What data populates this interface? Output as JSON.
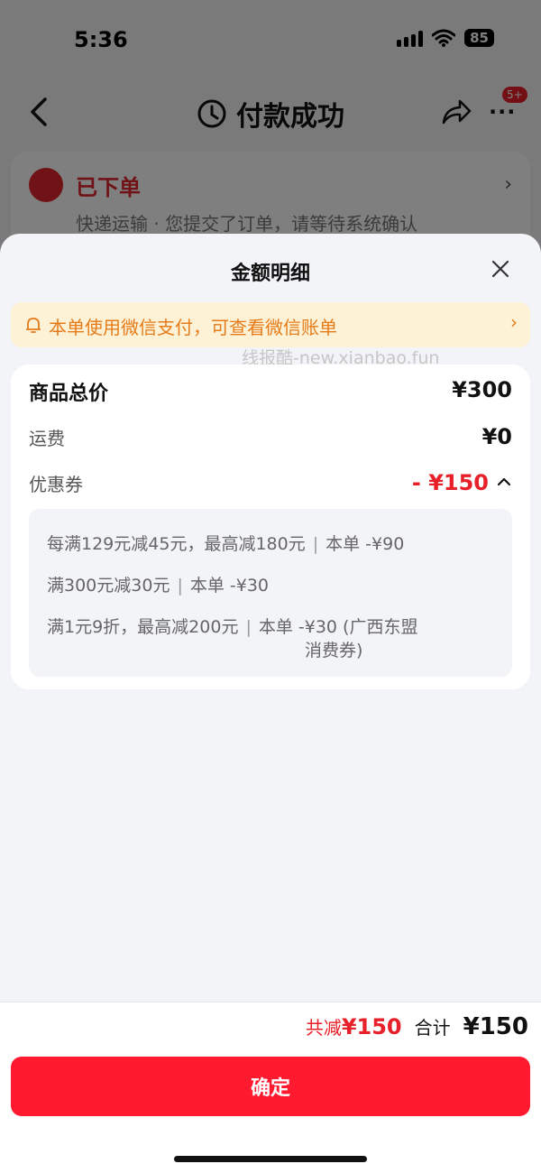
{
  "status_bar": {
    "time": "5:36",
    "battery": "85"
  },
  "nav": {
    "title": "付款成功",
    "badge": "5+",
    "more": "···"
  },
  "order": {
    "title": "已下单",
    "desc": "快递运输 · 您提交了订单，请等待系统确认"
  },
  "sheet": {
    "title": "金额明细",
    "wechat_banner": "本单使用微信支付，可查看微信账单",
    "watermark": "线报酷-new.xianbao.fun"
  },
  "detail": {
    "total_label": "商品总价",
    "total_value": "¥300",
    "shipping_label": "运费",
    "shipping_value": "¥0",
    "coupon_label": "优惠券",
    "coupon_value": "- ¥150",
    "coupons": [
      {
        "rule": "每满129元减45元，最高减180元",
        "applied": "本单 -¥90"
      },
      {
        "rule": "满300元减30元",
        "applied": "本单 -¥30"
      },
      {
        "rule": "满1元9折，最高减200元",
        "applied": "本单 -¥30 (广西东盟",
        "applied_cont": "消费券)"
      }
    ]
  },
  "footer": {
    "save_prefix": "共减",
    "save_amount": "¥150",
    "total_label": "合计",
    "total_amount": "¥150",
    "confirm_label": "确定"
  },
  "colors": {
    "accent_red": "#ff1a2f",
    "price_red": "#e8202a",
    "banner_orange": "#e57c19",
    "banner_bg": "#fdf1d6"
  }
}
